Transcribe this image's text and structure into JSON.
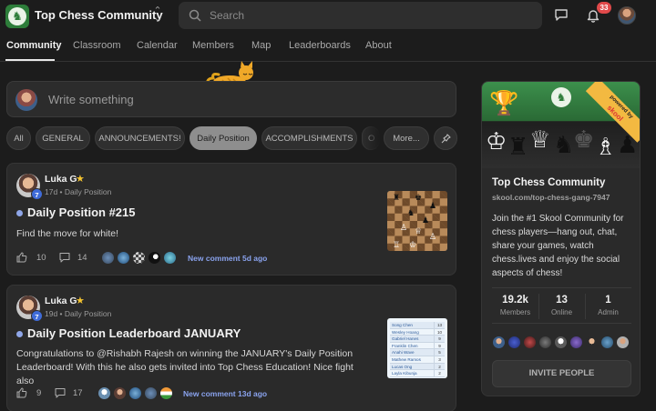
{
  "header": {
    "community_name": "Top Chess Community",
    "search_placeholder": "Search",
    "notification_count": "33"
  },
  "nav": {
    "tabs": [
      {
        "label": "Community",
        "active": true
      },
      {
        "label": "Classroom"
      },
      {
        "label": "Calendar"
      },
      {
        "label": "Members"
      },
      {
        "label": "Map"
      },
      {
        "label": "Leaderboards"
      },
      {
        "label": "About"
      }
    ]
  },
  "compose": {
    "placeholder": "Write something"
  },
  "filters": {
    "chips": [
      "All",
      "GENERAL",
      "ANNOUNCEMENTS!",
      "Daily Position",
      "ACCOMPLISHMENTS",
      "O",
      "More..."
    ],
    "active": "Daily Position"
  },
  "posts": [
    {
      "author": "Luka G",
      "level": "7",
      "meta": "17d • Daily Position",
      "title": "Daily Position #215",
      "body": "Find the move for white!",
      "likes": "10",
      "comments": "14",
      "new_comment": "New comment 5d ago"
    },
    {
      "author": "Luka G",
      "level": "7",
      "meta": "19d • Daily Position",
      "title": "Daily Position Leaderboard JANUARY",
      "body": "Congratulations to @Rishabh Rajesh on winning the JANUARY's Daily Position Leaderboard! With this he also gets invited into Top Chess Education! Nice fight also",
      "likes": "9",
      "comments": "17",
      "new_comment": "New comment 13d ago",
      "thumbnail_rows": [
        {
          "name": "Song Chen",
          "score": "13"
        },
        {
          "name": "Wesley Hoang",
          "score": "10"
        },
        {
          "name": "Gabriel Hanes",
          "score": "9"
        },
        {
          "name": "Franklin Chen",
          "score": "9"
        },
        {
          "name": "Anahi Wave",
          "score": "5"
        },
        {
          "name": "Mathew Ramos",
          "score": "3"
        },
        {
          "name": "Lucas Ong",
          "score": "2"
        },
        {
          "name": "Layla Kibunja",
          "score": "2"
        }
      ]
    }
  ],
  "sidebar": {
    "ribbon_top": "powered by",
    "ribbon_brand": "skool",
    "title": "Top Chess Community",
    "url": "skool.com/top-chess-gang-7947",
    "description": "Join the #1 Skool Community for chess players—hang out, chat, share your games, watch chess.lives and enjoy the social aspects of chess!",
    "stats": [
      {
        "value": "19.2k",
        "label": "Members"
      },
      {
        "value": "13",
        "label": "Online"
      },
      {
        "value": "1",
        "label": "Admin"
      }
    ],
    "invite_label": "INVITE PEOPLE"
  },
  "icons": {
    "search": "search-icon",
    "chat": "chat-icon",
    "bell": "bell-icon",
    "like": "thumbs-up-icon",
    "comment": "comment-icon",
    "pin": "pin-icon"
  },
  "colors": {
    "accent_link": "#8aa3ee",
    "level_badge": "#3f6bd8",
    "notification_badge": "#e0494a",
    "brand_green": "#2d7d3a"
  }
}
